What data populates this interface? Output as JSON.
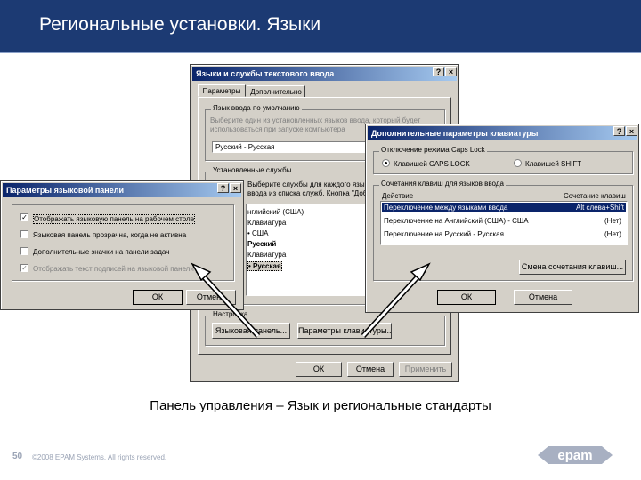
{
  "slide": {
    "title": "Региональные установки. Языки",
    "caption": "Панель управления – Язык и региональные стандарты",
    "page_number": "50",
    "copyright": "©2008 EPAM Systems. All rights reserved.",
    "logo_text": "epam"
  },
  "dialog_main": {
    "title": "Языки и службы текстового ввода",
    "tabs": [
      "Параметры",
      "Дополнительно"
    ],
    "group_lang_label": "Язык ввода по умолчанию",
    "group_lang_text": [
      "Выберите один из установленных языков ввода, который будет",
      "использоваться при запуске компьютера"
    ],
    "lang_select": "Русский - Русская",
    "group_services_label": "Установленные службы",
    "group_services_text": [
      "Выберите службы для каждого языка",
      "ввода из списка служб. Кнопка \"Доба"
    ],
    "services_items": [
      "нглийский (США)",
      "Клавиатура",
      "• США",
      "Русский",
      "Клавиатура",
      "• Русская"
    ],
    "group_settings_label": "Настройка",
    "btn_langbar": "Языковая панель...",
    "btn_keysettings": "Параметры клавиатуры...",
    "btn_ok": "ОК",
    "btn_cancel": "Отмена",
    "btn_apply": "Применить"
  },
  "dialog_langbar": {
    "title": "Параметры языковой панели",
    "options": [
      {
        "label": "Отображать языковую панель на рабочем столе",
        "checked": true
      },
      {
        "label": "Языковая панель прозрачна, когда не активна",
        "checked": false
      },
      {
        "label": "Дополнительные значки на панели задач",
        "checked": false
      },
      {
        "label": "Отображать текст подписей на языковой панели",
        "checked": true
      }
    ],
    "btn_ok": "ОК",
    "btn_cancel": "Отмена"
  },
  "dialog_keyboard": {
    "title": "Дополнительные параметры клавиатуры",
    "caps_group_label": "Отключение режима Caps Lock",
    "caps_option_1": "Клавишей CAPS LOCK",
    "caps_option_2": "Клавишей SHIFT",
    "hotkeys_group_label": "Сочетания клавиш для языков ввода",
    "col_action": "Действие",
    "col_keys": "Сочетание клавиш",
    "rows": [
      {
        "action": "Переключение между языками ввода",
        "keys": "Alt слева+Shift"
      },
      {
        "action": "Переключение на Английский (США) - США",
        "keys": "(Нет)"
      },
      {
        "action": "Переключение на Русский - Русская",
        "keys": "(Нет)"
      }
    ],
    "btn_change": "Смена сочетания клавиш...",
    "btn_ok": "ОК",
    "btn_cancel": "Отмена"
  },
  "titlebar_buttons": {
    "help": "?",
    "close": "×"
  },
  "colors": {
    "header_bg": "#1c3a73",
    "titlebar": "#0a246a",
    "selection": "#0a246a",
    "dialog_bg": "#d4d0c8",
    "logo": "#a8b0c2"
  }
}
